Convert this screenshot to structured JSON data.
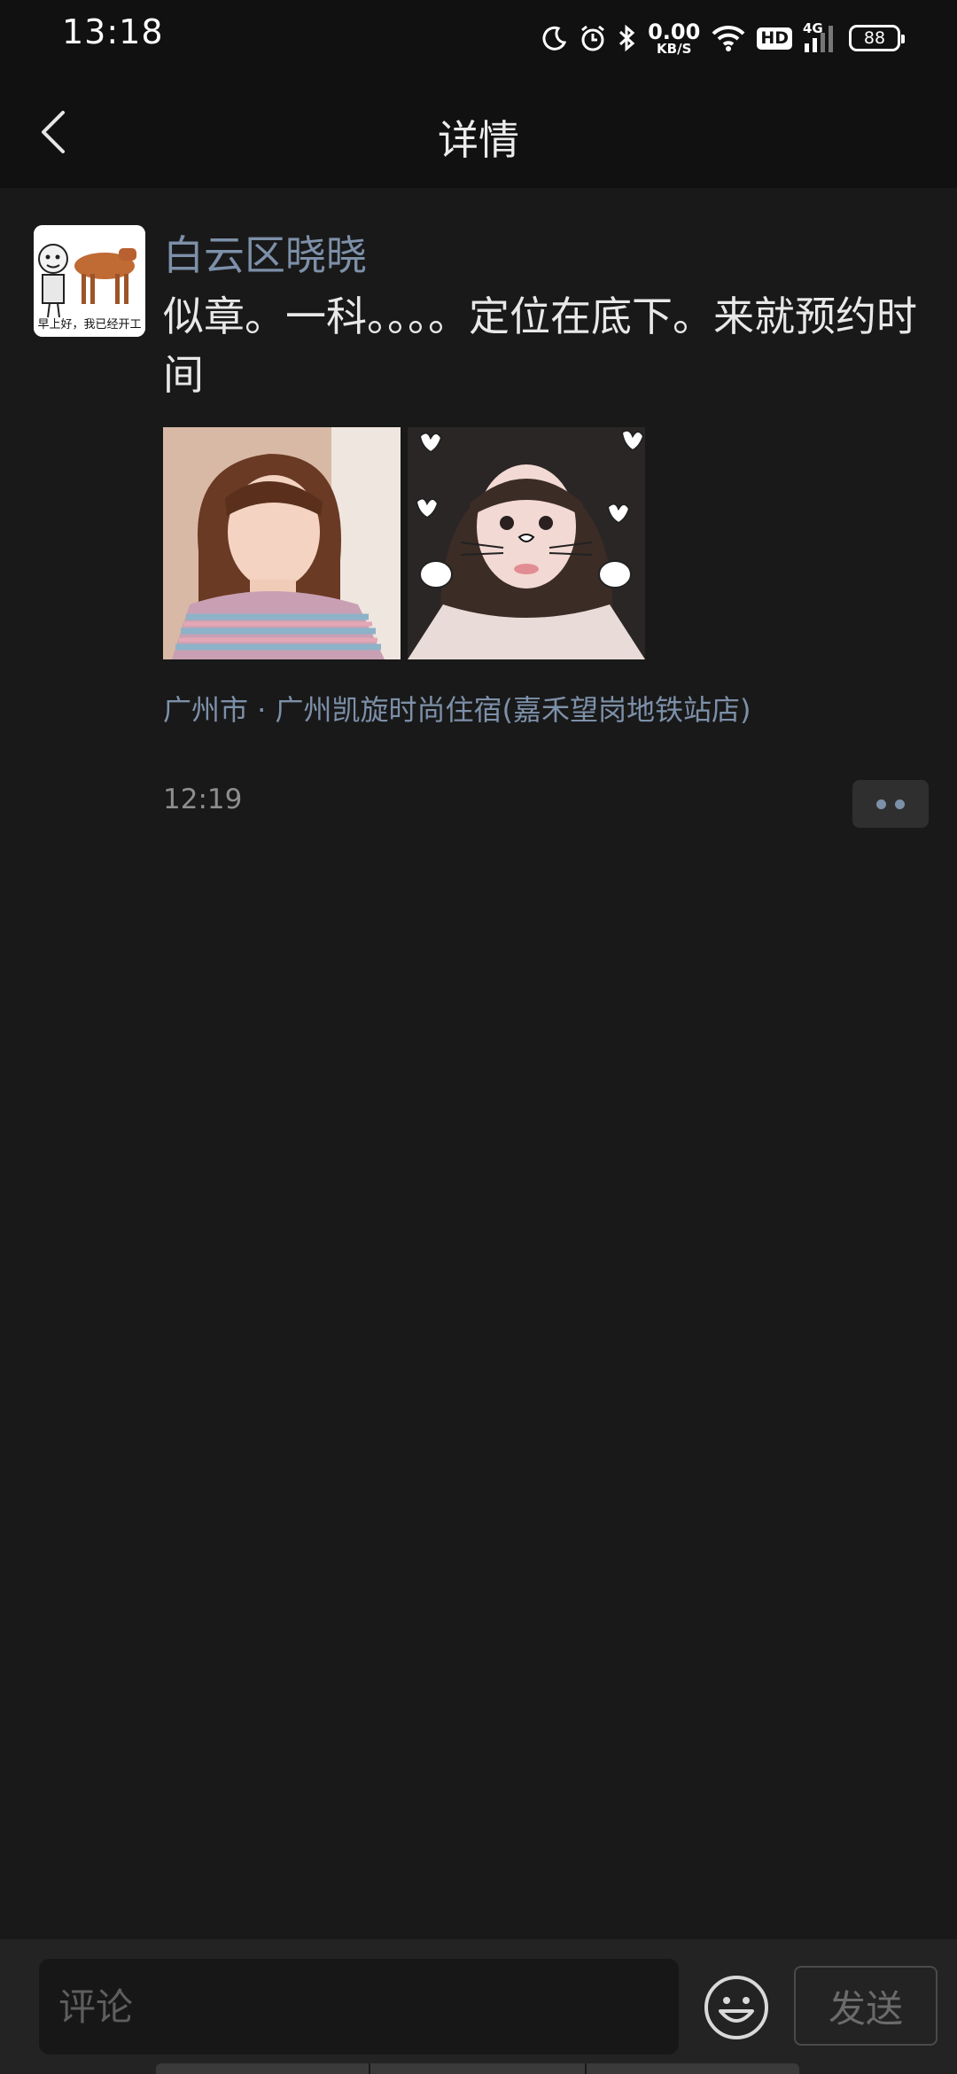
{
  "status_bar": {
    "time": "13:18",
    "net_speed_value": "0.00",
    "net_speed_unit": "KB/S",
    "hd_label": "HD",
    "network_label": "4G",
    "battery_level": "88",
    "icons": [
      "moon-icon",
      "alarm-icon",
      "bluetooth-icon",
      "wifi-icon",
      "signal-icon",
      "battery-icon"
    ]
  },
  "header": {
    "title": "详情",
    "back_icon": "chevron-left-icon"
  },
  "post": {
    "avatar_caption": "早上好，我已经开工",
    "author": "白云区晓晓",
    "text": "似章。一科。。。。定位在底下。来就预约时间",
    "photos": [
      "photo-1",
      "photo-2"
    ],
    "location": "广州市 · 广州凯旋时尚住宿(嘉禾望岗地铁站店)",
    "time": "12:19",
    "more_icon": "more-dots-icon"
  },
  "comment_bar": {
    "placeholder": "评论",
    "emoji_icon": "emoji-icon",
    "send_label": "发送"
  },
  "colors": {
    "background": "#191919",
    "bar": "#111111",
    "link": "#7d90a9"
  }
}
